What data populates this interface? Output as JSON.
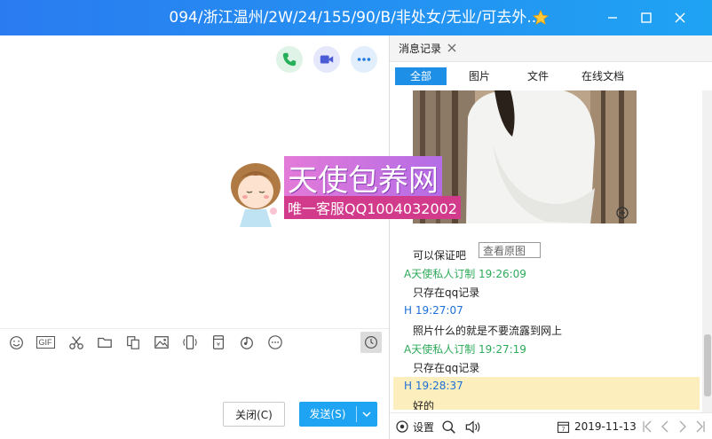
{
  "window": {
    "title": "094/浙江温州/2W/24/155/90/B/非处女/无业/可去外...",
    "minimize": "–",
    "maximize": "□",
    "close": "✕"
  },
  "chat": {
    "top_icons": [
      "phone-icon",
      "video-icon",
      "more-icon"
    ],
    "ad": {
      "line1": "天使包养网",
      "line2": "唯一客服QQ1004032002"
    },
    "toolbar": {
      "icons": [
        "emoji-icon",
        "gif-icon",
        "scissors-icon",
        "folder-icon",
        "font-icon",
        "image-icon",
        "shake-icon",
        "redpacket-icon",
        "music-icon",
        "more-icon"
      ],
      "gif_label": "GIF"
    },
    "close_button": "关闭(C)",
    "send_button": "发送(S)"
  },
  "history": {
    "tab_label": "消息记录",
    "filters": [
      "全部",
      "图片",
      "文件",
      "在线文档"
    ],
    "image_tooltip": "查看原图",
    "messages": [
      {
        "type": "body",
        "text": "可以保证吧"
      },
      {
        "type": "name-green",
        "text": "A天使私人订制 19:26:09"
      },
      {
        "type": "body",
        "text": "只存在qq记录"
      },
      {
        "type": "name-blue",
        "text": "H 19:27:07"
      },
      {
        "type": "body",
        "text": "照片什么的就是不要流露到网上"
      },
      {
        "type": "name-green",
        "text": "A天使私人订制 19:27:19"
      },
      {
        "type": "body",
        "text": "只存在qq记录"
      },
      {
        "type": "name-blue",
        "text": "H 19:28:37"
      },
      {
        "type": "body",
        "text": "好的"
      }
    ],
    "settings_label": "设置",
    "date": "2019-11-13"
  },
  "colors": {
    "accent": "#1fa3f3",
    "title_start": "#2a7bf0",
    "highlight": "#fdeebd",
    "green_name": "#2daa5a",
    "blue_name": "#1e6fd6"
  }
}
